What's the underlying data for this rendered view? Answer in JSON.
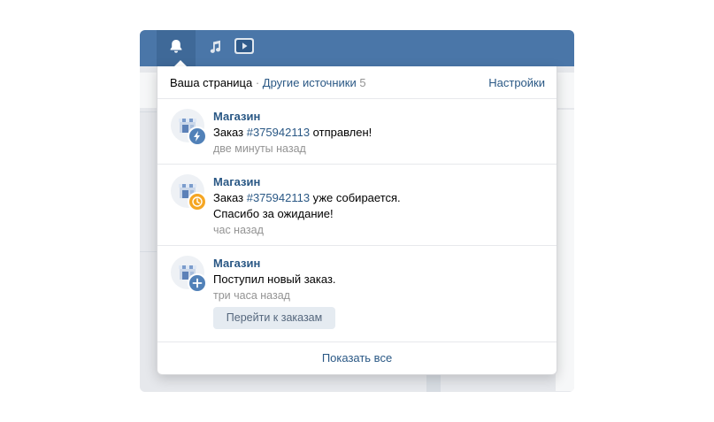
{
  "topbar": {
    "icons": [
      "bell-icon",
      "music-icon",
      "video-icon"
    ],
    "accent": "#4a76a8"
  },
  "header": {
    "your_page": "Ваша страница",
    "separator": "·",
    "other_sources": "Другие источники",
    "other_count": "5",
    "settings": "Настройки"
  },
  "notifications": [
    {
      "name": "Магазин",
      "text_before": "Заказ ",
      "order_link": "#375942113",
      "text_after": " отправлен!",
      "text_line2": "",
      "time": "две минуты назад",
      "badge_icon": "lightning-icon",
      "badge_color": "#5181b8"
    },
    {
      "name": "Магазин",
      "text_before": "Заказ ",
      "order_link": "#375942113",
      "text_after": " уже собирается.",
      "text_line2": "Спасибо за ожидание!",
      "time": "час назад",
      "badge_icon": "clock-icon",
      "badge_color": "#f5a623"
    },
    {
      "name": "Магазин",
      "text": "Поступил новый заказ.",
      "time": "три часа назад",
      "badge_icon": "plus-icon",
      "badge_color": "#5181b8",
      "button": "Перейти к заказам"
    }
  ],
  "footer": {
    "show_all": "Показать все"
  }
}
